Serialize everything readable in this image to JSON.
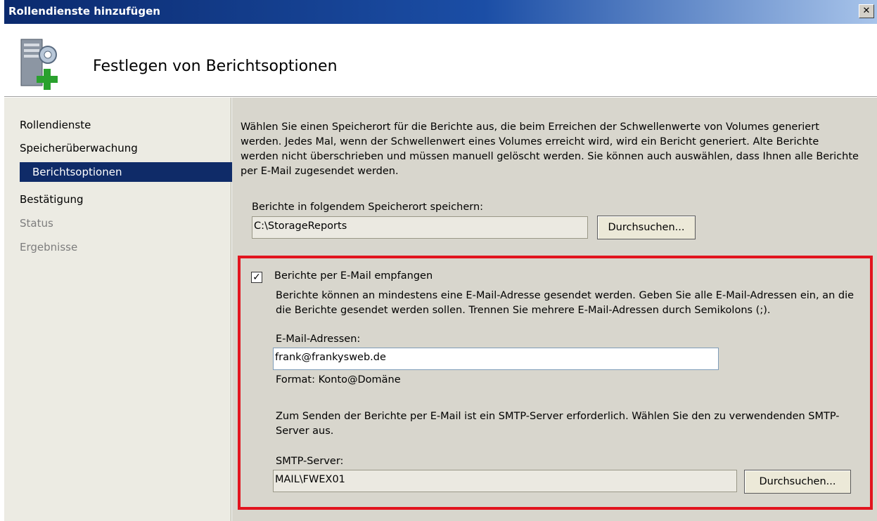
{
  "window": {
    "title": "Rollendienste hinzufügen",
    "close_glyph": "✕"
  },
  "header": {
    "heading": "Festlegen von Berichtsoptionen",
    "icon": "server-add-icon"
  },
  "sidebar": {
    "items": [
      {
        "label": "Rollendienste",
        "state": "normal"
      },
      {
        "label": "Speicherüberwachung",
        "state": "normal"
      },
      {
        "label": "Berichtsoptionen",
        "state": "selected"
      },
      {
        "label": "Bestätigung",
        "state": "normal"
      },
      {
        "label": "Status",
        "state": "disabled"
      },
      {
        "label": "Ergebnisse",
        "state": "disabled"
      }
    ]
  },
  "main": {
    "intro": "Wählen Sie einen Speicherort für die Berichte aus, die beim Erreichen der Schwellenwerte von Volumes generiert werden. Jedes Mal, wenn der Schwellenwert eines Volumes erreicht wird, wird ein Bericht generiert. Alte Berichte werden nicht überschrieben und müssen manuell gelöscht werden. Sie können auch auswählen, dass Ihnen alle Berichte per E-Mail zugesendet werden.",
    "location_label": "Berichte in folgendem Speicherort speichern:",
    "location_value": "C:\\StorageReports",
    "browse_label": "Durchsuchen...",
    "email": {
      "checkbox_label": "Berichte per E-Mail empfangen",
      "checked": true,
      "check_glyph": "✓",
      "description": "Berichte können an mindestens eine E-Mail-Adresse gesendet werden. Geben Sie alle E-Mail-Adressen ein, an die die Berichte gesendet werden sollen. Trennen Sie mehrere E-Mail-Adressen durch Semikolons (;).",
      "addresses_label": "E-Mail-Adressen:",
      "addresses_value": "frank@frankysweb.de",
      "format_hint": "Format: Konto@Domäne",
      "smtp_description": "Zum Senden der Berichte per E-Mail ist ein SMTP-Server erforderlich. Wählen Sie den zu verwendenden SMTP-Server aus.",
      "smtp_label": "SMTP-Server:",
      "smtp_value": "MAIL\\FWEX01",
      "browse_label": "Durchsuchen..."
    }
  },
  "colors": {
    "selection": "#0f2b68",
    "highlight_box": "#e2141e",
    "titlebar": "#0b2a6e"
  }
}
